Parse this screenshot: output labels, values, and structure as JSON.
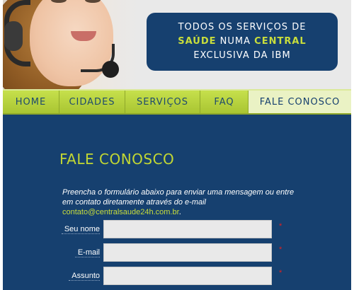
{
  "banner": {
    "line1": "TODOS OS SERVIÇOS DE",
    "line2_part1": "SAÚDE",
    "line2_part2": " NUMA ",
    "line2_part3": "CENTRAL",
    "line3": "EXCLUSIVA DA IBM"
  },
  "nav": {
    "items": [
      {
        "label": "HOME"
      },
      {
        "label": "CIDADES"
      },
      {
        "label": "SERVIÇOS"
      },
      {
        "label": "FAQ"
      },
      {
        "label": "FALE CONOSCO",
        "active": true
      }
    ]
  },
  "content": {
    "title": "FALE CONOSCO",
    "intro_text": "Preencha o formulário abaixo para enviar uma mensagem ou entre em contato diretamente através do e-mail ",
    "intro_email": "contato@centralsaude24h.com.br",
    "intro_end": "."
  },
  "form": {
    "fields": [
      {
        "label": "Seu nome",
        "value": "",
        "required_mark": "*"
      },
      {
        "label": "E-mail",
        "value": "",
        "required_mark": "*"
      },
      {
        "label": "Assunto",
        "value": "",
        "required_mark": "*"
      }
    ]
  },
  "colors": {
    "navy": "#16406f",
    "lime": "#c2d733",
    "nav_green": "#b7d43a"
  },
  "icons": {
    "headset": "headset-photo"
  }
}
